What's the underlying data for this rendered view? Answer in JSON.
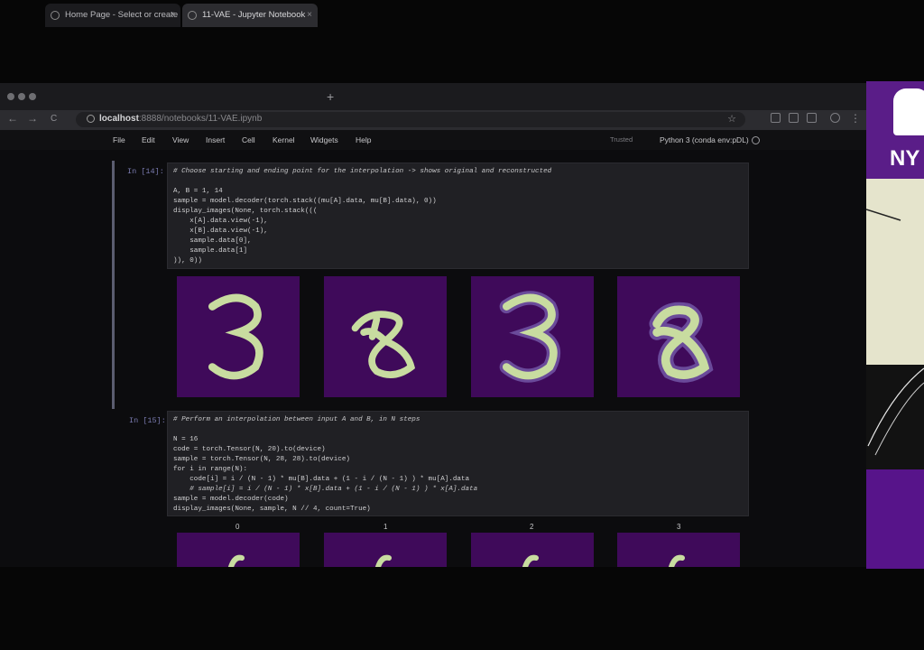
{
  "browser": {
    "tabs": [
      {
        "label": "Home Page - Select or create a"
      },
      {
        "label": "11-VAE - Jupyter Notebook"
      }
    ],
    "new_tab_label": "+",
    "url_host": "localhost",
    "url_path": ":8888/notebooks/11-VAE.ipynb",
    "back_icon": "←",
    "forward_icon": "→",
    "reload_icon": "C"
  },
  "jupyter": {
    "menu": [
      "File",
      "Edit",
      "View",
      "Insert",
      "Cell",
      "Kernel",
      "Widgets",
      "Help"
    ],
    "trusted": "Trusted",
    "kernel_name": "Python 3 (conda env:pDL)"
  },
  "cells": [
    {
      "prompt": "In [14]:",
      "code": [
        "# Choose starting and ending point for the interpolation -> shows original and reconstructed",
        "",
        "A, B = 1, 14",
        "sample = model.decoder(torch.stack((mu[A].data, mu[B].data), 0))",
        "display_images(None, torch.stack(((",
        "    x[A].data.view(-1),",
        "    x[B].data.view(-1),",
        "    sample.data[0],",
        "    sample.data[1]",
        ")), 0))"
      ]
    },
    {
      "prompt": "In [15]:",
      "code": [
        "# Perform an interpolation between input A and B, in N steps",
        "",
        "N = 16",
        "code = torch.Tensor(N, 20).to(device)",
        "sample = torch.Tensor(N, 28, 28).to(device)",
        "for i in range(N):",
        "    code[i] = i / (N - 1) * mu[B].data + (1 - i / (N - 1) ) * mu[A].data",
        "    # sample[i] = i / (N - 1) * x[B].data + (1 - i / (N - 1) ) * x[A].data",
        "sample = model.decoder(code)",
        "display_images(None, sample, N // 4, count=True)"
      ],
      "image_labels": [
        "0",
        "1",
        "2",
        "3"
      ]
    }
  ],
  "webcam": {
    "logo_text": "NY"
  },
  "colors": {
    "accent": "#5a1d88",
    "image_bg": "#3f0a5a",
    "digit": "#c8dca0"
  }
}
